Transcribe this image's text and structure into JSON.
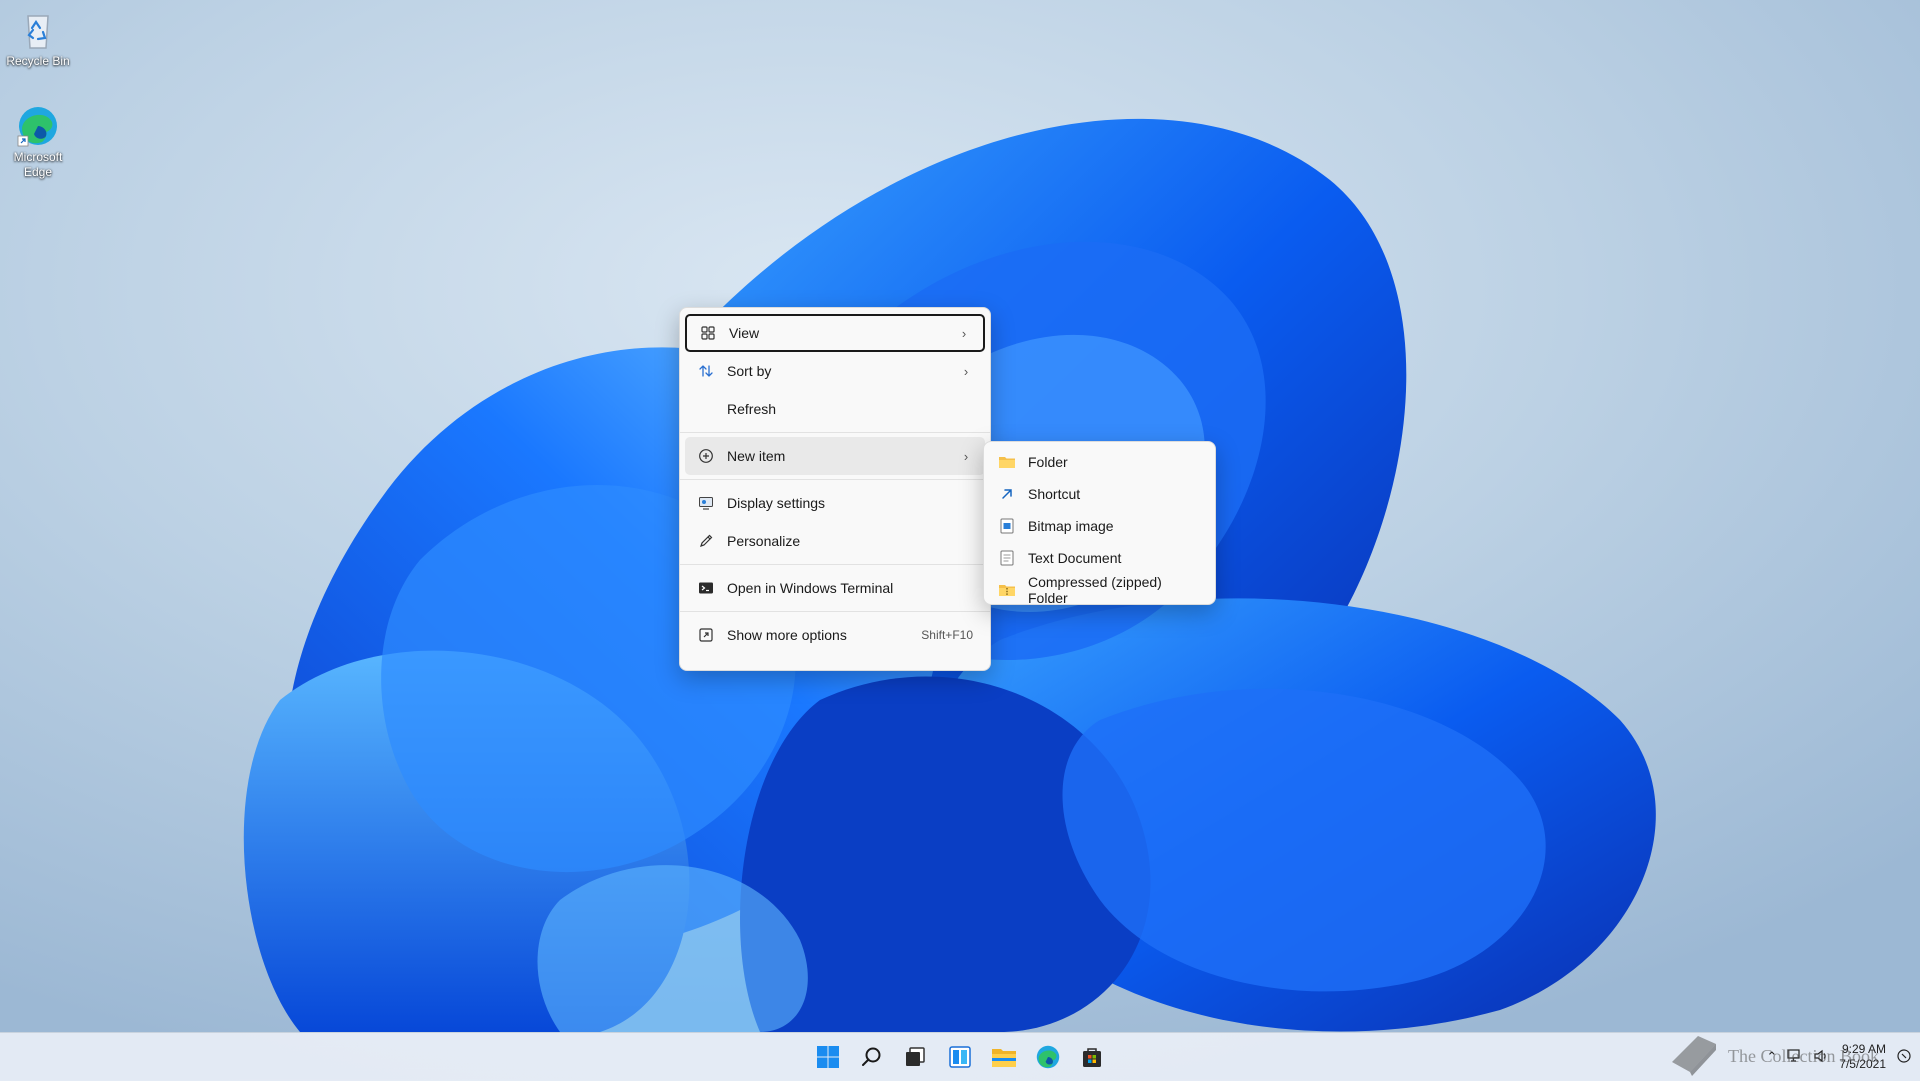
{
  "desktop": {
    "icons": [
      {
        "label": "Recycle Bin"
      },
      {
        "label": "Microsoft Edge"
      }
    ]
  },
  "context_menu": {
    "items": [
      {
        "label": "View",
        "icon": "grid-icon",
        "has_submenu": true
      },
      {
        "label": "Sort by",
        "icon": "sort-icon",
        "has_submenu": true
      },
      {
        "label": "Refresh",
        "icon": null
      },
      {
        "label": "New item",
        "icon": "plus-circle-icon",
        "has_submenu": true
      },
      {
        "label": "Display settings",
        "icon": "display-icon"
      },
      {
        "label": "Personalize",
        "icon": "pen-icon"
      },
      {
        "label": "Open in Windows Terminal",
        "icon": "terminal-icon"
      },
      {
        "label": "Show more options",
        "icon": "expand-icon",
        "shortcut": "Shift+F10"
      }
    ]
  },
  "new_item_submenu": {
    "items": [
      {
        "label": "Folder",
        "icon": "folder-icon"
      },
      {
        "label": "Shortcut",
        "icon": "shortcut-icon"
      },
      {
        "label": "Bitmap image",
        "icon": "bitmap-icon"
      },
      {
        "label": "Text Document",
        "icon": "text-document-icon"
      },
      {
        "label": "Compressed (zipped) Folder",
        "icon": "zip-folder-icon"
      }
    ]
  },
  "taskbar": {
    "icons": [
      "start-icon",
      "search-icon",
      "task-view-icon",
      "widgets-icon",
      "file-explorer-icon",
      "edge-icon",
      "store-icon"
    ]
  },
  "tray": {
    "time": "9:29 AM",
    "date": "7/5/2021"
  },
  "watermark": {
    "text": "The Collection Book"
  },
  "colors": {
    "accent": "#0067c0",
    "menu_bg": "#f9f9f9",
    "taskbar_bg": "#e8eef6"
  }
}
